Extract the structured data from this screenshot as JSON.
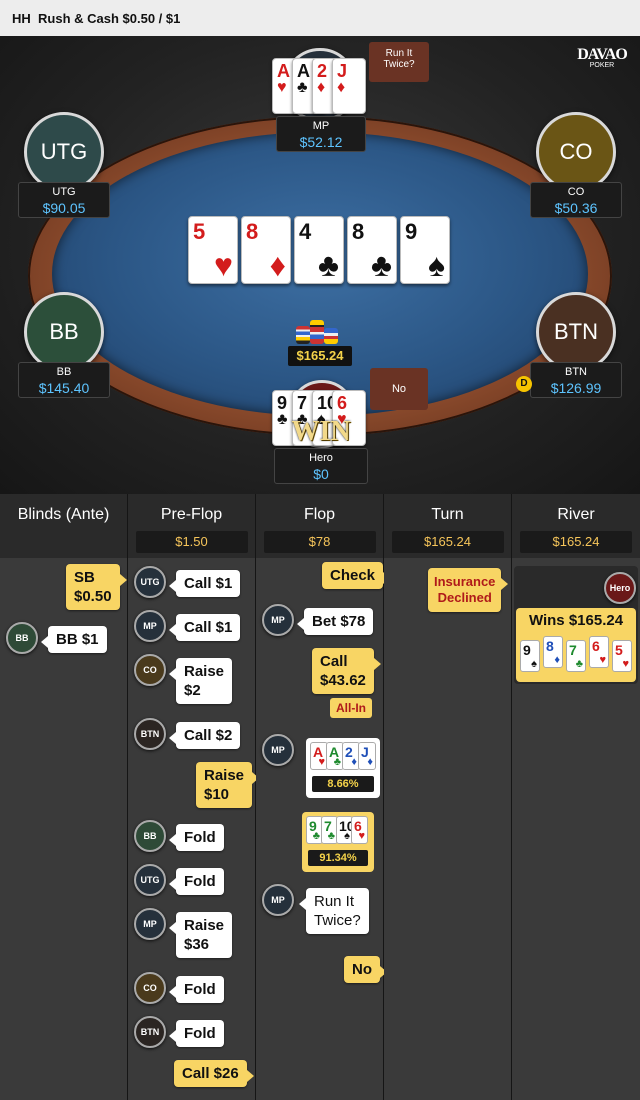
{
  "header": {
    "hand_prefix": "HH",
    "title": "Rush & Cash $0.50 / $1"
  },
  "brand": {
    "logo_line1": "DAVAO",
    "logo_line2": "POKER"
  },
  "table": {
    "seats": {
      "mp": {
        "label": "MP",
        "stack": "$52.12",
        "cards": [
          {
            "rank": "A",
            "suit": "♥",
            "color": "red"
          },
          {
            "rank": "A",
            "suit": "♣",
            "color": "black"
          },
          {
            "rank": "2",
            "suit": "♦",
            "color": "red"
          },
          {
            "rank": "J",
            "suit": "♦",
            "color": "red"
          }
        ],
        "bubble": "Run It Twice?"
      },
      "utg": {
        "circle": "UTG",
        "label": "UTG",
        "stack": "$90.05",
        "color": "#2e4a4a"
      },
      "co": {
        "circle": "CO",
        "label": "CO",
        "stack": "$50.36",
        "color": "#6a5515"
      },
      "bb": {
        "circle": "BB",
        "label": "BB",
        "stack": "$145.40",
        "color": "#2c4f3a"
      },
      "btn": {
        "circle": "BTN",
        "label": "BTN",
        "stack": "$126.99",
        "color": "#4a3022",
        "dealer": "D"
      },
      "hero": {
        "label": "Hero",
        "stack": "$0",
        "cards": [
          {
            "rank": "9",
            "suit": "♣",
            "color": "black"
          },
          {
            "rank": "7",
            "suit": "♣",
            "color": "black"
          },
          {
            "rank": "10",
            "suit": "♠",
            "color": "black"
          },
          {
            "rank": "6",
            "suit": "♥",
            "color": "red"
          }
        ],
        "bubble": "No",
        "win": "WIN"
      }
    },
    "board": [
      {
        "rank": "5",
        "suit": "♥",
        "color": "red"
      },
      {
        "rank": "8",
        "suit": "♦",
        "color": "red"
      },
      {
        "rank": "4",
        "suit": "♣",
        "color": "black"
      },
      {
        "rank": "8",
        "suit": "♣",
        "color": "black"
      },
      {
        "rank": "9",
        "suit": "♠",
        "color": "black"
      }
    ],
    "pot": "$165.24"
  },
  "history": {
    "columns": [
      {
        "name": "Blinds (Ante)",
        "pot": ""
      },
      {
        "name": "Pre-Flop",
        "pot": "$1.50"
      },
      {
        "name": "Flop",
        "pot": "$78"
      },
      {
        "name": "Turn",
        "pot": "$165.24"
      },
      {
        "name": "River",
        "pot": "$165.24"
      }
    ],
    "blinds": {
      "sb": "SB\n$0.50",
      "bb_badge": "BB",
      "bb": "BB $1"
    },
    "preflop": [
      {
        "badge": "UTG",
        "text": "Call $1"
      },
      {
        "badge": "MP",
        "text": "Call $1"
      },
      {
        "badge": "CO",
        "text": "Raise\n$2"
      },
      {
        "badge": "BTN",
        "text": "Call $2"
      },
      {
        "hero": "Raise\n$10"
      },
      {
        "badge": "BB",
        "text": "Fold"
      },
      {
        "badge": "UTG",
        "text": "Fold"
      },
      {
        "badge": "MP",
        "text": "Raise\n$36"
      },
      {
        "badge": "CO",
        "text": "Fold"
      },
      {
        "badge": "BTN",
        "text": "Fold"
      },
      {
        "hero": "Call $26"
      }
    ],
    "flop": {
      "hero_check": "Check",
      "mp_bet_badge": "MP",
      "mp_bet": "Bet $78",
      "hero_call": "Call\n$43.62",
      "all_in": "All-In",
      "mp_show_badge": "MP",
      "mp_cards": [
        "A",
        "A",
        "2",
        "J"
      ],
      "mp_equity": "8.66%",
      "hero_cards": [
        "9",
        "7",
        "10",
        "6"
      ],
      "hero_equity": "91.34%",
      "mp_rit_badge": "MP",
      "mp_rit": "Run It\nTwice?",
      "hero_no": "No"
    },
    "turn": {
      "insurance": "Insurance\nDeclined"
    },
    "river": {
      "badge": "Hero",
      "wins": "Wins $165.24",
      "cards": [
        {
          "rank": "9",
          "suit": "♠",
          "color": "black"
        },
        {
          "rank": "8",
          "suit": "♦",
          "color": "blue"
        },
        {
          "rank": "7",
          "suit": "♣",
          "color": "green"
        },
        {
          "rank": "6",
          "suit": "♥",
          "color": "red"
        },
        {
          "rank": "5",
          "suit": "♥",
          "color": "red"
        }
      ]
    }
  }
}
